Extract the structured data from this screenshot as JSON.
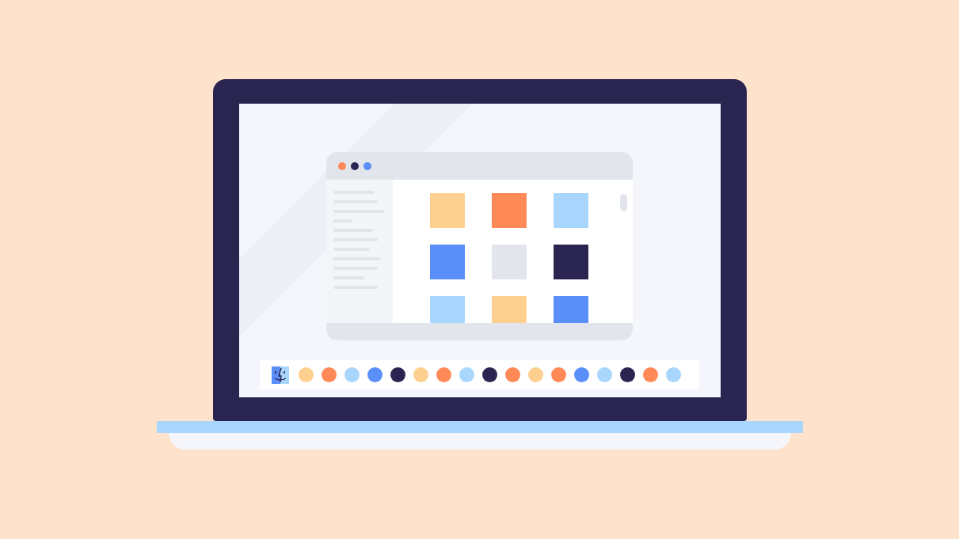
{
  "window": {
    "buttons": [
      {
        "color": "#ff8a57"
      },
      {
        "color": "#2a2550"
      },
      {
        "color": "#5a8ef9"
      }
    ]
  },
  "files": [
    {
      "color": "#fdd08f"
    },
    {
      "color": "#ff8a57"
    },
    {
      "color": "#a9d6fd"
    },
    {
      "color": "#5a8ef9"
    },
    {
      "color": "#e2e5ec"
    },
    {
      "color": "#2a2550"
    },
    {
      "color": "#a9d6fd"
    },
    {
      "color": "#fdd08f"
    },
    {
      "color": "#5a8ef9"
    }
  ],
  "dock": {
    "items": [
      {
        "color": "#fdd08f"
      },
      {
        "color": "#ff8a57"
      },
      {
        "color": "#a9d6fd"
      },
      {
        "color": "#5a8ef9"
      },
      {
        "color": "#2a2550"
      },
      {
        "color": "#fdd08f"
      },
      {
        "color": "#ff8a57"
      },
      {
        "color": "#a9d6fd"
      },
      {
        "color": "#2a2550"
      },
      {
        "color": "#ff8a57"
      },
      {
        "color": "#fdd08f"
      },
      {
        "color": "#ff8a57"
      },
      {
        "color": "#5a8ef9"
      },
      {
        "color": "#a9d6fd"
      },
      {
        "color": "#2a2550"
      },
      {
        "color": "#ff8a57"
      },
      {
        "color": "#a9d6fd"
      }
    ]
  }
}
